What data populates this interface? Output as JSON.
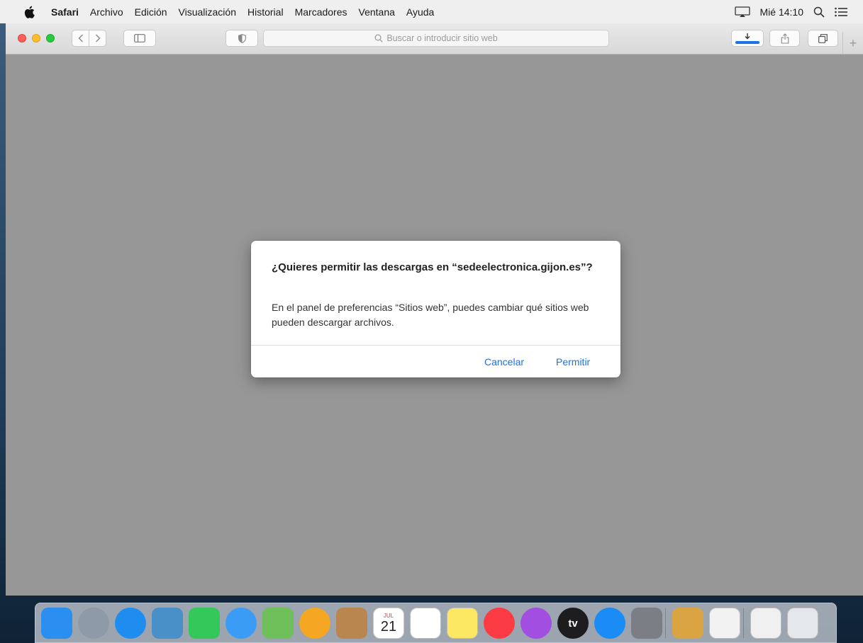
{
  "menubar": {
    "apple_icon": "apple-icon",
    "items": [
      "Safari",
      "Archivo",
      "Edición",
      "Visualización",
      "Historial",
      "Marcadores",
      "Ventana",
      "Ayuda"
    ],
    "clock": "Mié 14:10",
    "icons": [
      "display-mirroring-icon",
      "spotlight-search-icon",
      "notification-center-icon"
    ]
  },
  "safari": {
    "address_placeholder": "Buscar o introducir sitio web",
    "colors": {
      "close": "#fe5f57",
      "minimize": "#febc2e",
      "maximize": "#28c840",
      "download_progress": "#1a73e8",
      "content_bg": "#979797"
    },
    "toolbar_icons": [
      "back-icon",
      "forward-icon",
      "sidebar-icon",
      "privacy-shield-icon",
      "search-icon",
      "download-icon",
      "share-icon",
      "tab-overview-icon",
      "new-tab-icon"
    ]
  },
  "dialog": {
    "title": "¿Quieres permitir las descargas en “sedeelectronica.gijon.es”?",
    "body": "En el panel de preferencias “Sitios web”, puedes cambiar qué sitios web pueden descargar archivos.",
    "cancel_label": "Cancelar",
    "allow_label": "Permitir",
    "accent": "#1a73e8"
  },
  "dock": {
    "apps": [
      {
        "name": "finder-icon",
        "color": "#2a8ff0"
      },
      {
        "name": "launchpad-icon",
        "color": "#8e9aa8"
      },
      {
        "name": "safari-icon",
        "color": "#1f8cf0"
      },
      {
        "name": "mail-preview-icon",
        "color": "#4a90c8"
      },
      {
        "name": "facetime-icon",
        "color": "#34c759"
      },
      {
        "name": "messages-icon",
        "color": "#3a9cf5"
      },
      {
        "name": "maps-icon",
        "color": "#6fbf5a"
      },
      {
        "name": "photos-icon",
        "color": "#f5a623"
      },
      {
        "name": "contacts-icon",
        "color": "#b98650"
      },
      {
        "name": "calendar-icon",
        "color": "#ffffff",
        "text": "21",
        "month": "JUL"
      },
      {
        "name": "reminders-icon",
        "color": "#ffffff"
      },
      {
        "name": "notes-icon",
        "color": "#fce762"
      },
      {
        "name": "music-icon",
        "color": "#fc3c44"
      },
      {
        "name": "podcasts-icon",
        "color": "#a24ee0"
      },
      {
        "name": "apple-tv-icon",
        "color": "#1d1d1f",
        "text": "tv"
      },
      {
        "name": "app-store-icon",
        "color": "#1b8bf5"
      },
      {
        "name": "system-preferences-icon",
        "color": "#7b7f85"
      },
      {
        "name": "keychain-access-icon",
        "color": "#d9a441"
      },
      {
        "name": "textedit-icon",
        "color": "#f2f2f2"
      },
      {
        "name": "downloads-folder-icon",
        "color": "#f0f0f0"
      },
      {
        "name": "trash-icon",
        "color": "#e4e8ec"
      }
    ]
  }
}
